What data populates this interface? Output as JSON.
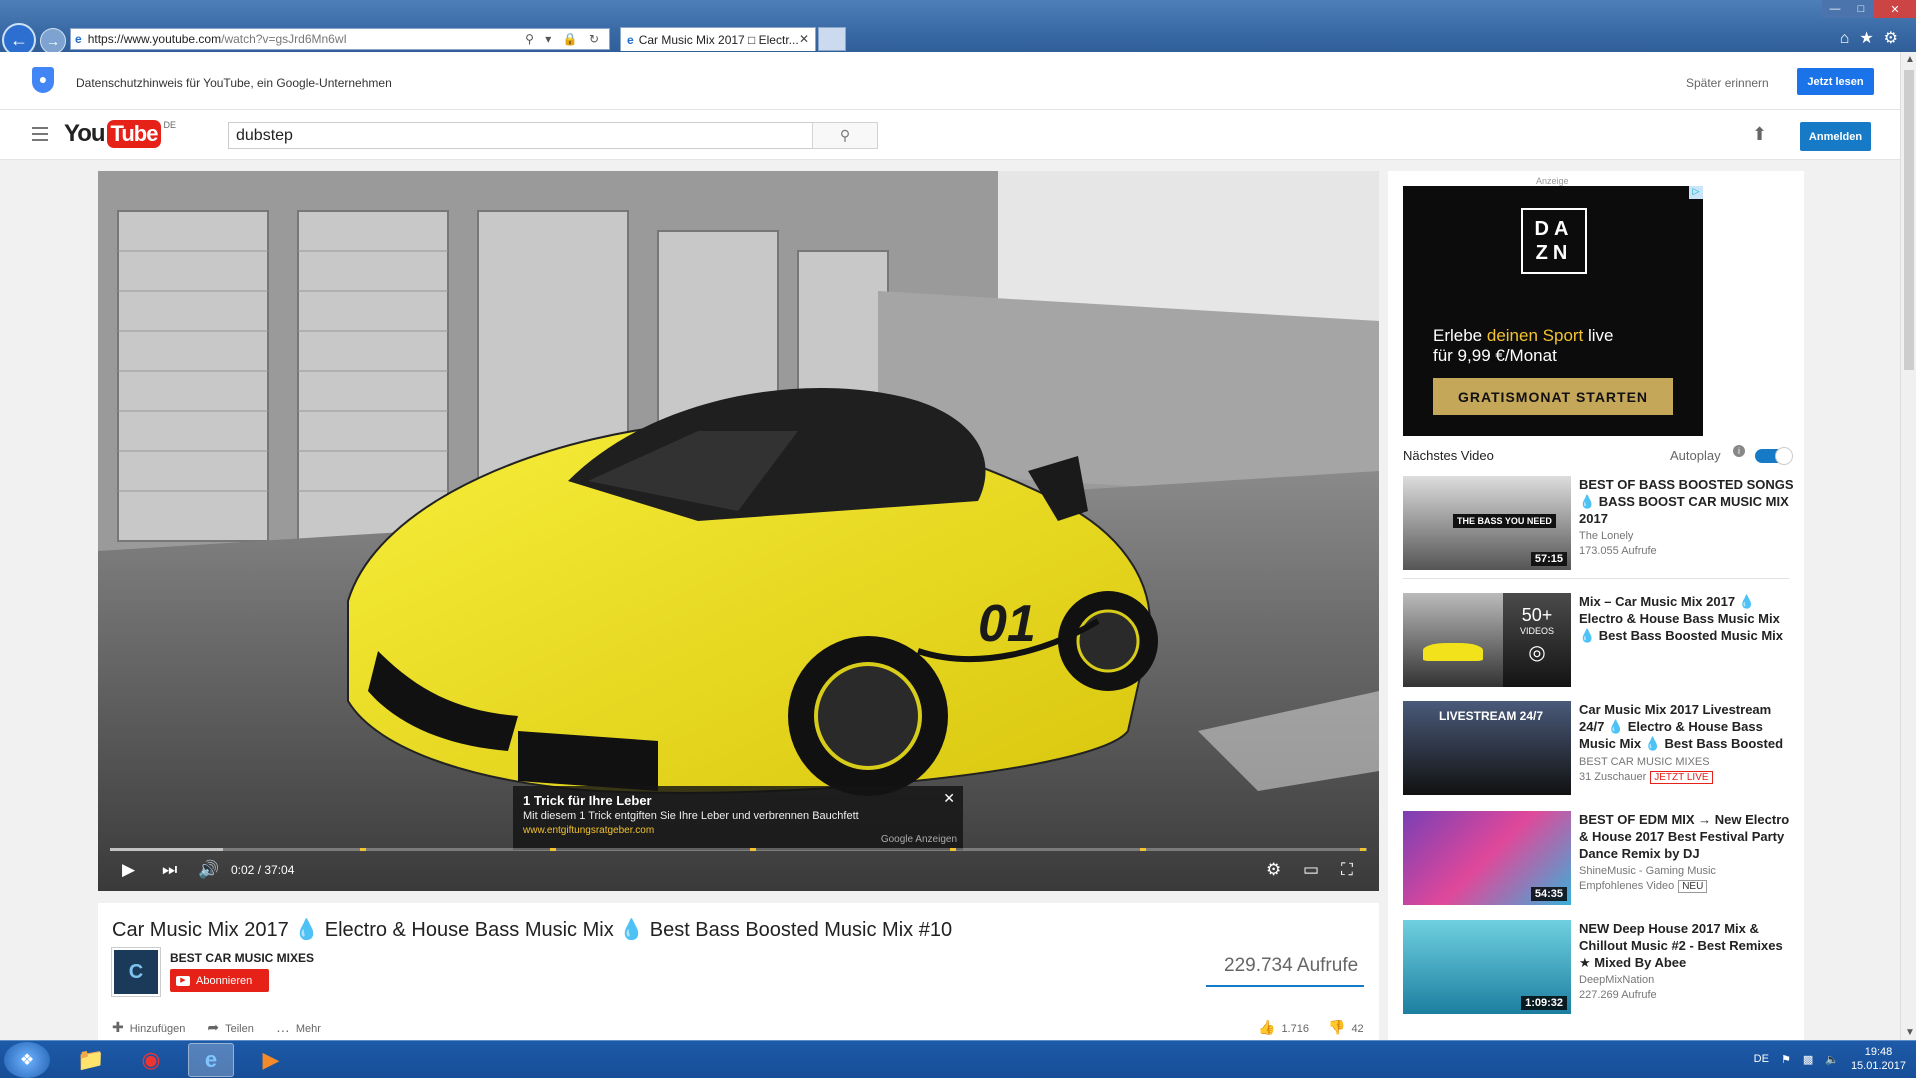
{
  "browser": {
    "url_prefix": "https://",
    "url_domain": "www.youtube.com",
    "url_path": "/watch?v=gsJrd6Mn6wI",
    "tab_title": "Car Music Mix 2017 □ Electr..."
  },
  "privacy": {
    "text": "Datenschutzhinweis für YouTube, ein Google-Unternehmen",
    "later": "Später erinnern",
    "read_now": "Jetzt lesen"
  },
  "header": {
    "logo_you": "You",
    "logo_tube": "Tube",
    "logo_country": "DE",
    "search_value": "dubstep",
    "signin": "Anmelden"
  },
  "player": {
    "time": "0:02 / 37:04",
    "progress_fraction": 0.001,
    "buffered_fraction": 0.09,
    "car_number": "01",
    "ad": {
      "title": "1 Trick für Ihre Leber",
      "desc": "Mit diesem 1 Trick entgiften Sie Ihre Leber und verbrennen Bauchfett",
      "url": "www.entgiftungsratgeber.com",
      "source": "Google Anzeigen"
    }
  },
  "video": {
    "title": "Car Music Mix 2017 💧 Electro & House Bass Music Mix 💧 Best Bass Boosted Music Mix #10",
    "channel": "BEST CAR MUSIC MIXES",
    "subscribe": "Abonnieren",
    "views": "229.734 Aufrufe",
    "actions": {
      "add": "Hinzufügen",
      "share": "Teilen",
      "more": "Mehr"
    },
    "likes": "1.716",
    "dislikes": "42"
  },
  "sidebar": {
    "ad_label": "Anzeige",
    "dazn": {
      "logo_top": "DA",
      "logo_bottom": "ZN",
      "line1_a": "Erlebe ",
      "line1_b": "deinen Sport",
      "line1_c": " live",
      "line2": "für 9,99 €/Monat",
      "cta": "GRATISMONAT STARTEN"
    },
    "next_label": "Nächstes Video",
    "autoplay_label": "Autoplay",
    "autoplay_on": true,
    "items": [
      {
        "title": "BEST OF BASS BOOSTED SONGS 💧 BASS BOOST CAR MUSIC MIX 2017",
        "channel": "The Lonely",
        "meta": "173.055 Aufrufe",
        "duration": "57:15",
        "thumb_text": "THE BASS YOU NEED"
      },
      {
        "title": "Mix – Car Music Mix 2017 💧 Electro & House Bass Music Mix 💧 Best Bass Boosted Music Mix",
        "channel": "",
        "meta": "",
        "duration": "",
        "thumb_text": "50+",
        "thumb_sub": "VIDEOS"
      },
      {
        "title": "Car Music Mix 2017 Livestream 24/7 💧 Electro & House Bass Music Mix 💧 Best Bass Boosted",
        "channel": "BEST CAR MUSIC MIXES",
        "meta": "31 Zuschauer",
        "badge": "JETZT LIVE",
        "duration": "",
        "thumb_text": "LIVESTREAM 24/7"
      },
      {
        "title": "BEST OF EDM MIX → New Electro & House 2017 Best Festival Party Dance Remix by DJ",
        "channel": "ShineMusic - Gaming Music",
        "meta": "Empfohlenes Video",
        "badge": "NEU",
        "duration": "54:35",
        "thumb_text": ""
      },
      {
        "title": "NEW Deep House 2017 Mix & Chillout Music #2 - Best Remixes ★ Mixed By Abee",
        "channel": "DeepMixNation",
        "meta": "227.269 Aufrufe",
        "duration": "1:09:32",
        "thumb_text": ""
      }
    ]
  },
  "taskbar": {
    "lang": "DE",
    "time": "19:48",
    "date": "15.01.2017"
  },
  "colors": {
    "yt_red": "#e62117",
    "yt_blue": "#167ac6",
    "ad_yellow": "#f2c230",
    "car_yellow": "#f2e21c"
  }
}
